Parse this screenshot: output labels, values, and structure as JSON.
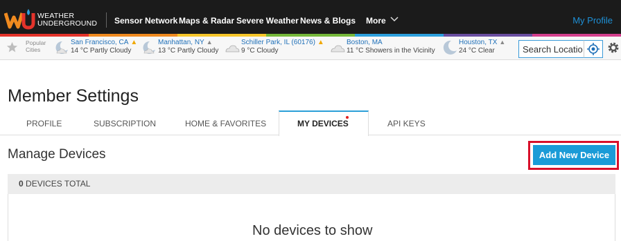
{
  "brand": {
    "logo_text_line1": "WEATHER",
    "logo_text_line2": "UNDERGROUND",
    "stripe_colors": [
      "#e4332b",
      "#f08a1f",
      "#f7c62a",
      "#75b83a",
      "#2c9fdc",
      "#6a4ea0",
      "#d43f8d"
    ]
  },
  "nav": {
    "items": [
      "Sensor Network",
      "Maps & Radar",
      "Severe Weather",
      "News & Blogs"
    ],
    "more_label": "More",
    "profile_label": "My Profile"
  },
  "cities": {
    "popular_line1": "Popular",
    "popular_line2": "Cities",
    "list": [
      {
        "name": "San Francisco, CA",
        "condition": "14 °C Partly Cloudy",
        "icon": "moon-cloud-icon",
        "alert": "warning"
      },
      {
        "name": "Manhattan, NY",
        "condition": "13 °C Partly Cloudy",
        "icon": "moon-cloud-icon",
        "alert": "grey"
      },
      {
        "name": "Schiller Park, IL (60176)",
        "condition": "9 °C Cloudy",
        "icon": "cloud-icon",
        "alert": "warning"
      },
      {
        "name": "Boston, MA",
        "condition": "11 °C Showers in the Vicinity",
        "icon": "cloud-icon",
        "alert": "none"
      },
      {
        "name": "Houston, TX",
        "condition": "24 °C Clear",
        "icon": "moon-icon",
        "alert": "grey"
      }
    ],
    "search_value": "Search Locatio"
  },
  "page": {
    "title": "Member Settings",
    "tabs": [
      "PROFILE",
      "SUBSCRIPTION",
      "HOME & FAVORITES",
      "MY DEVICES",
      "API KEYS"
    ],
    "active_tab": "MY DEVICES",
    "section_title": "Manage Devices",
    "add_button": "Add New Device",
    "devices_count": "0",
    "devices_total_label": "DEVICES TOTAL",
    "empty_message": "No devices to show"
  },
  "colors": {
    "accent": "#1a9bd7",
    "highlight_frame": "#d8102a",
    "header_bg": "#1b1b1b"
  }
}
